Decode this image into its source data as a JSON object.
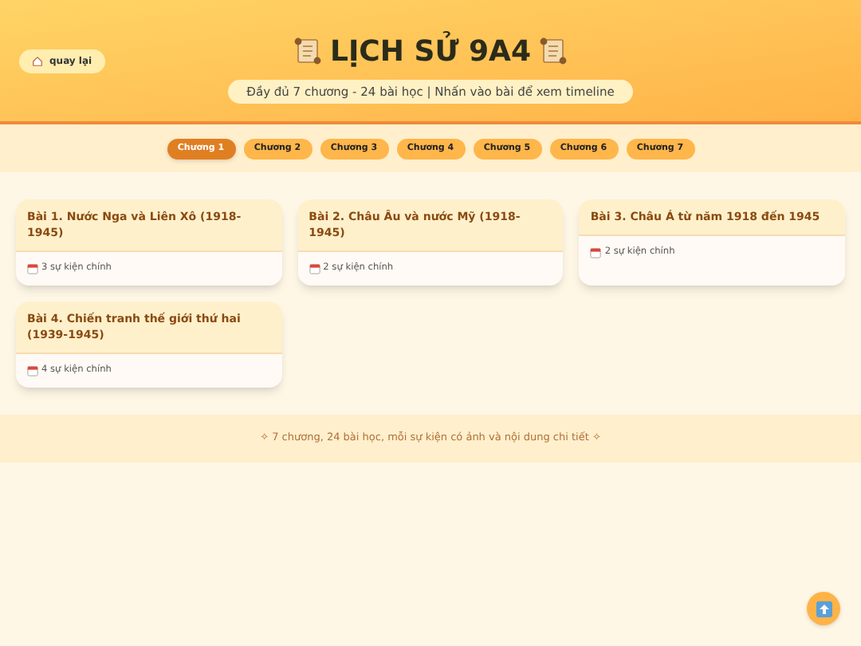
{
  "header": {
    "back_button": "quay lại",
    "title": "LỊCH SỬ 9A4",
    "subtitle": "Đầy đủ 7 chương - 24 bài học | Nhấn vào bài để xem timeline"
  },
  "tabs": [
    {
      "label": "Chương 1",
      "selected": true
    },
    {
      "label": "Chương 2",
      "selected": false
    },
    {
      "label": "Chương 3",
      "selected": false
    },
    {
      "label": "Chương 4",
      "selected": false
    },
    {
      "label": "Chương 5",
      "selected": false
    },
    {
      "label": "Chương 6",
      "selected": false
    },
    {
      "label": "Chương 7",
      "selected": false
    }
  ],
  "lessons": [
    {
      "title": "Bài 1. Nước Nga và Liên Xô (1918-1945)",
      "events": "3 sự kiện chính"
    },
    {
      "title": "Bài 2. Châu Âu và nước Mỹ (1918-1945)",
      "events": "2 sự kiện chính"
    },
    {
      "title": "Bài 3. Châu Á từ năm 1918 đến 1945",
      "events": "2 sự kiện chính"
    },
    {
      "title": "Bài 4. Chiến tranh thế giới thứ hai (1939-1945)",
      "events": "4 sự kiện chính"
    }
  ],
  "footer": "✧ 7 chương, 24 bài học, mỗi sự kiện có ảnh và nội dung chi tiết ✧"
}
